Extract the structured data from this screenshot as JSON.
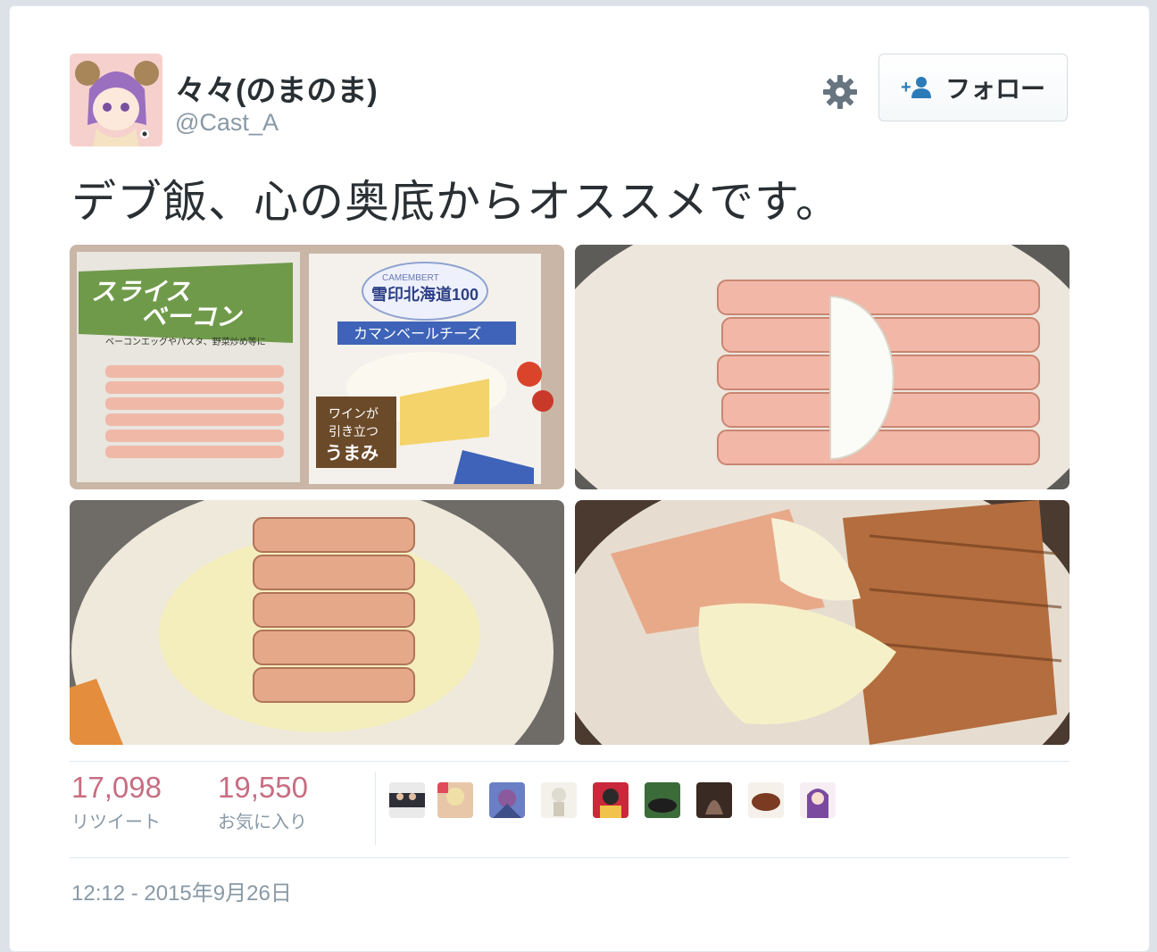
{
  "user": {
    "display_name": "々々(のまのま)",
    "handle": "@Cast_A",
    "avatar": "avatar-image"
  },
  "actions": {
    "settings_icon": "gear-icon",
    "follow_icon": "follow-user-icon",
    "follow_label": "フォロー"
  },
  "tweet": {
    "text": "デブ飯、心の奥底からオススメです。",
    "photos": [
      {
        "name": "bacon-and-camembert-packages",
        "bacon_package": {
          "line1": "スライス",
          "line2": "ベーコン",
          "subtitle": "ベーコンエッグやパスタ、野菜炒め等に"
        },
        "cheese_package": {
          "brand_top": "CAMEMBERT",
          "brand": "雪印北海道100",
          "product": "カマンベールチーズ",
          "badge_line1": "ワインが",
          "badge_line2": "引き立つ",
          "badge_line3": "うまみ"
        }
      },
      {
        "name": "bacon-wrapped-cheese-raw"
      },
      {
        "name": "bacon-cheese-in-pan"
      },
      {
        "name": "cooked-bacon-melted-cheese"
      }
    ]
  },
  "stats": {
    "retweets": {
      "count": "17,098",
      "label": "リツイート"
    },
    "favorites": {
      "count": "19,550",
      "label": "お気に入り"
    }
  },
  "favorited_by": [
    "user-avatar-1",
    "user-avatar-2",
    "user-avatar-3",
    "user-avatar-4",
    "user-avatar-5",
    "user-avatar-6",
    "user-avatar-7",
    "user-avatar-8",
    "user-avatar-9"
  ],
  "timestamp": "12:12 - 2015年9月26日",
  "colors": {
    "text": "#292f33",
    "muted": "#8899a6",
    "stat_number": "#c86d82",
    "follow_icon": "#2b7bb9",
    "border": "#e1e8ed"
  }
}
